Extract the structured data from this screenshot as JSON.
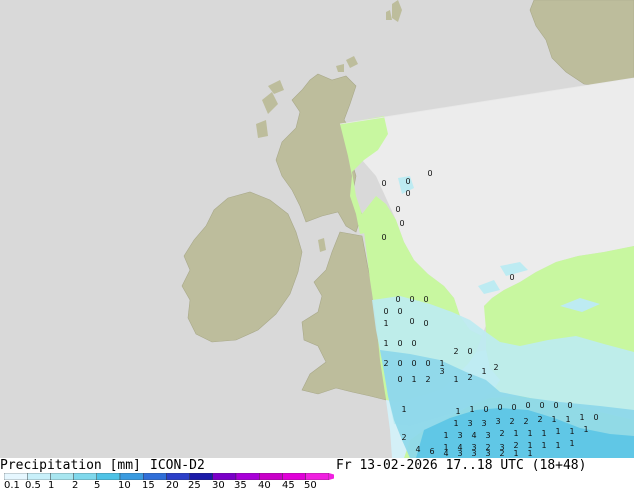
{
  "title": {
    "product": "Precipitation [mm]",
    "model": "ICON-D2",
    "valid_time": "Fr 13-02-2026 17..18 UTC (18+48)"
  },
  "legend": {
    "ticks": [
      "0.1",
      "0.5",
      "1",
      "2",
      "5",
      "10",
      "15",
      "20",
      "25",
      "30",
      "35",
      "40",
      "45",
      "50"
    ],
    "colors": [
      "#e6f7ff",
      "#c8f0fa",
      "#a8e6f0",
      "#7fd8ec",
      "#4fc3e6",
      "#3a9be0",
      "#2f6ed8",
      "#2b3fc8",
      "#1a1aa8",
      "#7a00c8",
      "#a800d8",
      "#c800c8",
      "#e000d8",
      "#f020e0"
    ]
  },
  "map": {
    "colors": {
      "sea": "#d9d9d9",
      "land": "#bdbd9c",
      "no_data": "#ececec",
      "domain_land": "#c8f7a0",
      "precip_light": "#bdebf2",
      "precip_moderate": "#8ed8ea",
      "precip_heavy": "#5ec6e6"
    },
    "point_values": [
      "0",
      "0",
      "0",
      "0",
      "0",
      "0",
      "0",
      "0",
      "0",
      "0",
      "0",
      "0",
      "0",
      "1",
      "0",
      "0",
      "1",
      "0",
      "0",
      "2",
      "0",
      "0",
      "0",
      "1",
      "2",
      "0",
      "0",
      "1",
      "2",
      "3",
      "1",
      "2",
      "1",
      "2",
      "1",
      "1",
      "1",
      "0",
      "0",
      "0",
      "0",
      "0",
      "0",
      "0",
      "1",
      "3",
      "3",
      "3",
      "2",
      "2",
      "2",
      "1",
      "1",
      "1",
      "0",
      "1",
      "3",
      "4",
      "3",
      "2",
      "1",
      "1",
      "1",
      "1",
      "1",
      "1",
      "1",
      "4",
      "3",
      "2",
      "3",
      "2",
      "1",
      "1",
      "1",
      "1",
      "2",
      "4",
      "6",
      "4",
      "3",
      "3",
      "3",
      "2",
      "1",
      "1"
    ]
  }
}
